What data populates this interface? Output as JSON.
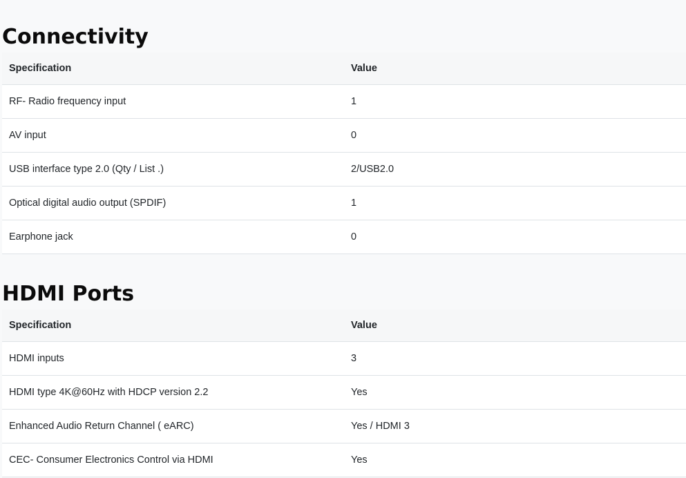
{
  "connectivity": {
    "title": "Connectivity",
    "headers": {
      "spec": "Specification",
      "value": "Value"
    },
    "rows": [
      {
        "spec": "RF- Radio frequency input",
        "value": "1"
      },
      {
        "spec": "AV input",
        "value": "0"
      },
      {
        "spec": "USB interface type 2.0 (Qty / List .)",
        "value": "2/USB2.0"
      },
      {
        "spec": "Optical digital audio output (SPDIF)",
        "value": "1"
      },
      {
        "spec": "Earphone jack",
        "value": "0"
      }
    ]
  },
  "hdmi": {
    "title": "HDMI Ports",
    "headers": {
      "spec": "Specification",
      "value": "Value"
    },
    "rows": [
      {
        "spec": "HDMI inputs",
        "value": "3"
      },
      {
        "spec": "HDMI type 4K@60Hz with HDCP version 2.2",
        "value": "Yes"
      },
      {
        "spec": "Enhanced Audio Return Channel ( eARC)",
        "value": "Yes / HDMI 3"
      },
      {
        "spec": "CEC- Consumer Electronics Control via HDMI",
        "value": "Yes"
      }
    ]
  }
}
